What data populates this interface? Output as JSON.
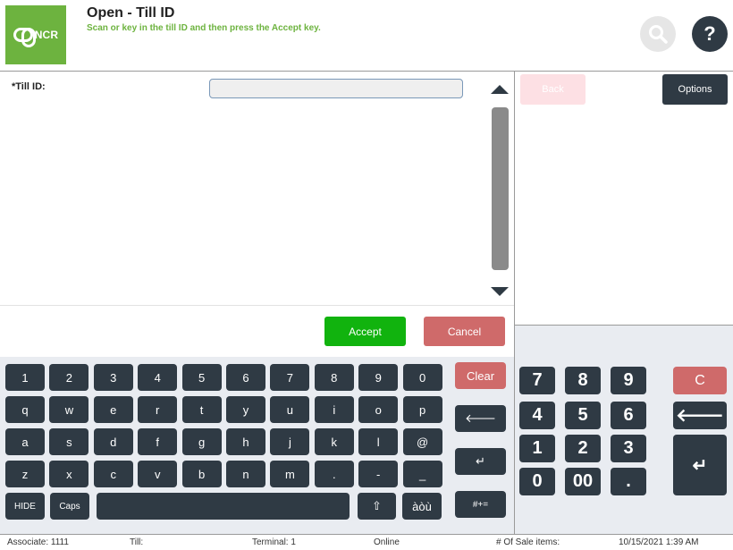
{
  "header": {
    "logo_text": "NCR",
    "title": "Open - Till ID",
    "subtitle": "Scan or key in the till ID and then press the Accept key.",
    "help_glyph": "?",
    "icons": [
      "search-icon",
      "help-icon"
    ]
  },
  "form": {
    "till_label": "*Till ID:",
    "till_value": ""
  },
  "actions": {
    "accept": "Accept",
    "cancel": "Cancel"
  },
  "right_panel": {
    "back": "Back",
    "options": "Options"
  },
  "keyboard": {
    "row1": [
      "1",
      "2",
      "3",
      "4",
      "5",
      "6",
      "7",
      "8",
      "9",
      "0"
    ],
    "row2": [
      "q",
      "w",
      "e",
      "r",
      "t",
      "y",
      "u",
      "i",
      "o",
      "p"
    ],
    "row3": [
      "a",
      "s",
      "d",
      "f",
      "g",
      "h",
      "j",
      "k",
      "l",
      "@"
    ],
    "row4": [
      "z",
      "x",
      "c",
      "v",
      "b",
      "n",
      "m",
      ".",
      "-",
      "_"
    ],
    "hide": "HIDE",
    "caps": "Caps",
    "shift": "⇧",
    "accent": "àòù",
    "clear": "Clear",
    "backspace": "🡐",
    "enter": "↵",
    "symbols": "#+="
  },
  "numpad": {
    "row1": [
      "7",
      "8",
      "9"
    ],
    "row2": [
      "4",
      "5",
      "6"
    ],
    "row3": [
      "1",
      "2",
      "3"
    ],
    "row4": [
      "0",
      "00",
      "."
    ],
    "c": "C",
    "backspace": "🡐",
    "enter": "↵"
  },
  "status_bar": {
    "associate": "Associate: 1111",
    "till": "Till:",
    "terminal": "Terminal: 1",
    "online": "Online",
    "sale_items": "# Of Sale items:",
    "datetime": "10/15/2021 1:39 AM"
  },
  "colors": {
    "brand_green": "#6db33f",
    "accept_green": "#11b30e",
    "cancel_red": "#cf6a6a",
    "key_dark": "#2f3a44",
    "keyboard_bg": "#e9ecf1"
  }
}
